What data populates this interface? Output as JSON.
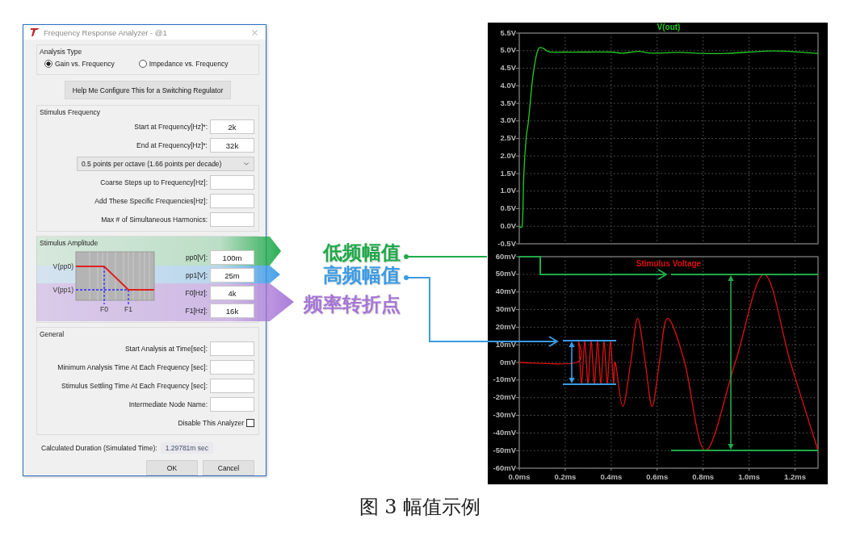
{
  "dialog": {
    "title": "Frequency Response Analyzer - @1",
    "analysis_type": {
      "title": "Analysis Type",
      "options": [
        {
          "label": "Gain vs. Frequency",
          "selected": true
        },
        {
          "label": "Impedance vs. Frequency",
          "selected": false
        }
      ]
    },
    "configure_button": "Help Me Configure This for a Switching Regulator",
    "stimulus_frequency": {
      "title": "Stimulus Frequency",
      "fields": [
        {
          "kind": "input",
          "label": "Start at Frequency[Hz]*:",
          "value": "2k"
        },
        {
          "kind": "input",
          "label": "End at Frequency[Hz]*:",
          "value": "32k"
        },
        {
          "kind": "select",
          "value": "0.5 points per octave (1.66 points per decade)"
        },
        {
          "kind": "input",
          "label": "Coarse Steps up to Frequency[Hz]:"
        },
        {
          "kind": "input",
          "label": "Add These Specific Frequencies[Hz]:"
        },
        {
          "kind": "input",
          "label": "Max # of Simultaneous Harmonics:"
        }
      ]
    },
    "stimulus_amplitude": {
      "title": "Stimulus Amplitude",
      "diagram_labels": [
        "V(pp0)",
        "V(pp1)",
        "F0",
        "F1"
      ],
      "fields": [
        {
          "kind": "input",
          "label": "pp0[V]:",
          "value": "100m"
        },
        {
          "kind": "input",
          "label": "pp1[V]:",
          "value": "25m"
        },
        {
          "kind": "input",
          "label": "F0[Hz]:",
          "value": "4k"
        },
        {
          "kind": "input",
          "label": "F1[Hz]:",
          "value": "16k"
        }
      ]
    },
    "general": {
      "title": "General",
      "fields": [
        {
          "kind": "input",
          "label": "Start Analysis at Time[sec]:"
        },
        {
          "kind": "input",
          "label": "Minimum Analysis Time At Each Frequency [sec]:"
        },
        {
          "kind": "input",
          "label": "Stimulus Settling Time At Each Frequency [sec]:"
        },
        {
          "kind": "input",
          "label": "Intermediate Node Name:"
        },
        {
          "kind": "checkbox",
          "label": "Disable This Analyzer",
          "checked": false
        }
      ]
    },
    "duration": {
      "label": "Calculated Duration (Simulated Time):",
      "value": "1.29781m sec"
    },
    "buttons": [
      "OK",
      "Cancel"
    ]
  },
  "annotations": [
    {
      "text": "低频幅值",
      "color": "#1faa4a"
    },
    {
      "text": "高频幅值",
      "color": "#3a9be6"
    },
    {
      "text": "频率转折点",
      "color": "#a675d6"
    }
  ],
  "plots": [
    {
      "chart_data": {
        "type": "line",
        "grid": true,
        "xlim": [
          0,
          1.3
        ],
        "ylim": [
          -0.5,
          5.5
        ],
        "yticks": [
          {
            "value": 5.5,
            "label": "5.5V"
          },
          {
            "value": 5,
            "label": "5.0V"
          },
          {
            "value": 4.5,
            "label": "4.5V"
          },
          {
            "value": 4,
            "label": "4.0V"
          },
          {
            "value": 3.5,
            "label": "3.5V"
          },
          {
            "value": 3,
            "label": "3.0V"
          },
          {
            "value": 2.5,
            "label": "2.5V"
          },
          {
            "value": 2,
            "label": "2.0V"
          },
          {
            "value": 1.5,
            "label": "1.5V"
          },
          {
            "value": 1,
            "label": "1.0V"
          },
          {
            "value": 0.5,
            "label": "0.5V"
          },
          {
            "value": 0,
            "label": "0.0V"
          },
          {
            "value": -0.5,
            "label": "-0.5V"
          }
        ],
        "x": [
          0,
          0.012,
          0.016,
          0.02,
          0.03,
          0.04,
          0.06,
          0.08,
          0.1,
          0.13,
          0.2,
          0.3,
          0.4,
          0.45,
          0.52,
          0.58,
          0.7,
          0.8,
          0.9,
          1.0,
          1.1,
          1.2,
          1.3
        ],
        "series": [
          {
            "name": "V(out)",
            "color": "#22cc22",
            "values": [
              0,
              0,
              0.5,
              1.5,
              2.5,
              3.0,
              4.3,
              5.0,
              5.08,
              4.97,
              4.96,
              4.96,
              4.96,
              4.93,
              4.98,
              4.93,
              4.95,
              4.92,
              4.92,
              4.96,
              4.99,
              4.97,
              4.92
            ]
          }
        ]
      }
    },
    {
      "chart_data": {
        "type": "line",
        "grid": true,
        "xlim": [
          0,
          1.3
        ],
        "ylim": [
          -60,
          60
        ],
        "yticks": [
          {
            "value": 60,
            "label": "60mV"
          },
          {
            "value": 50,
            "label": "50mV"
          },
          {
            "value": 40,
            "label": "40mV"
          },
          {
            "value": 30,
            "label": "30mV"
          },
          {
            "value": 20,
            "label": "20mV"
          },
          {
            "value": 10,
            "label": "10mV"
          },
          {
            "value": 0,
            "label": "0mV"
          },
          {
            "value": -10,
            "label": "-10mV"
          },
          {
            "value": -20,
            "label": "-20mV"
          },
          {
            "value": -30,
            "label": "-30mV"
          },
          {
            "value": -40,
            "label": "-40mV"
          },
          {
            "value": -50,
            "label": "-50mV"
          },
          {
            "value": -60,
            "label": "-60mV"
          }
        ],
        "xticks": [
          {
            "value": 0,
            "label": "0.0ms"
          },
          {
            "value": 0.2,
            "label": "0.2ms"
          },
          {
            "value": 0.4,
            "label": "0.4ms"
          },
          {
            "value": 0.6,
            "label": "0.6ms"
          },
          {
            "value": 0.8,
            "label": "0.8ms"
          },
          {
            "value": 1.0,
            "label": "1.0ms"
          },
          {
            "value": 1.2,
            "label": "1.2ms"
          }
        ],
        "x": [
          0,
          0.25,
          0.257,
          0.264,
          0.271,
          0.278,
          0.285,
          0.292,
          0.299,
          0.306,
          0.313,
          0.32,
          0.327,
          0.334,
          0.341,
          0.348,
          0.355,
          0.362,
          0.369,
          0.376,
          0.383,
          0.39,
          0.397,
          0.404,
          0.411,
          0.418,
          0.45,
          0.485,
          0.515,
          0.548,
          0.578,
          0.61,
          0.645,
          0.72,
          0.81,
          0.94,
          1.065,
          1.18,
          1.3
        ],
        "series": [
          {
            "name": "Stimulus Voltage",
            "color": "#dd1111",
            "values": [
              0,
              0,
              12.5,
              0,
              -12.5,
              0,
              12.5,
              0,
              -12.5,
              0,
              12.5,
              0,
              -12.5,
              0,
              12.5,
              0,
              -12.5,
              0,
              12.5,
              0,
              -12.5,
              0,
              12.5,
              0,
              -12.5,
              0,
              -25,
              0,
              25,
              0,
              -25,
              0,
              25,
              0,
              -50,
              0,
              50,
              0,
              -50
            ]
          }
        ]
      }
    }
  ],
  "caption": "图 3 幅值示例"
}
